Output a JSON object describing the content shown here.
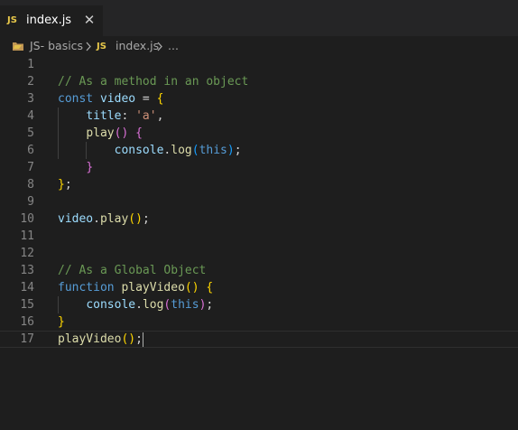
{
  "tab": {
    "badge": "JS",
    "filename": "index.js",
    "close_glyph": "✕"
  },
  "breadcrumb": {
    "folder": "JS- basics",
    "separator": ">",
    "file_badge": "JS",
    "file": "index.js",
    "more": "..."
  },
  "editor": {
    "language": "javascript",
    "active_line": 17,
    "lines": [
      {
        "n": "1",
        "tokens": []
      },
      {
        "n": "2",
        "tokens": [
          {
            "t": "// As a method in an object",
            "c": "comment"
          }
        ]
      },
      {
        "n": "3",
        "tokens": [
          {
            "t": "const",
            "c": "kw"
          },
          {
            "t": " ",
            "c": "punc"
          },
          {
            "t": "video",
            "c": "var"
          },
          {
            "t": " = ",
            "c": "punc"
          },
          {
            "t": "{",
            "c": "b1"
          }
        ]
      },
      {
        "n": "4",
        "tokens": [
          {
            "t": "    ",
            "c": "punc"
          },
          {
            "t": "title",
            "c": "prop"
          },
          {
            "t": ": ",
            "c": "punc"
          },
          {
            "t": "'a'",
            "c": "str"
          },
          {
            "t": ",",
            "c": "punc"
          }
        ]
      },
      {
        "n": "5",
        "tokens": [
          {
            "t": "    ",
            "c": "punc"
          },
          {
            "t": "play",
            "c": "fn"
          },
          {
            "t": "()",
            "c": "b2"
          },
          {
            "t": " ",
            "c": "punc"
          },
          {
            "t": "{",
            "c": "b2"
          }
        ]
      },
      {
        "n": "6",
        "tokens": [
          {
            "t": "        ",
            "c": "punc"
          },
          {
            "t": "console",
            "c": "var"
          },
          {
            "t": ".",
            "c": "punc"
          },
          {
            "t": "log",
            "c": "fn"
          },
          {
            "t": "(",
            "c": "b3"
          },
          {
            "t": "this",
            "c": "this"
          },
          {
            "t": ")",
            "c": "b3"
          },
          {
            "t": ";",
            "c": "punc"
          }
        ]
      },
      {
        "n": "7",
        "tokens": [
          {
            "t": "    ",
            "c": "punc"
          },
          {
            "t": "}",
            "c": "b2"
          }
        ]
      },
      {
        "n": "8",
        "tokens": [
          {
            "t": "}",
            "c": "b1"
          },
          {
            "t": ";",
            "c": "punc"
          }
        ]
      },
      {
        "n": "9",
        "tokens": []
      },
      {
        "n": "10",
        "tokens": [
          {
            "t": "video",
            "c": "var"
          },
          {
            "t": ".",
            "c": "punc"
          },
          {
            "t": "play",
            "c": "fn"
          },
          {
            "t": "()",
            "c": "b1"
          },
          {
            "t": ";",
            "c": "punc"
          }
        ]
      },
      {
        "n": "11",
        "tokens": []
      },
      {
        "n": "12",
        "tokens": []
      },
      {
        "n": "13",
        "tokens": [
          {
            "t": "// As a Global Object",
            "c": "comment"
          }
        ]
      },
      {
        "n": "14",
        "tokens": [
          {
            "t": "function",
            "c": "kw"
          },
          {
            "t": " ",
            "c": "punc"
          },
          {
            "t": "playVideo",
            "c": "fn"
          },
          {
            "t": "()",
            "c": "b1"
          },
          {
            "t": " ",
            "c": "punc"
          },
          {
            "t": "{",
            "c": "b1"
          }
        ]
      },
      {
        "n": "15",
        "tokens": [
          {
            "t": "    ",
            "c": "punc"
          },
          {
            "t": "console",
            "c": "var"
          },
          {
            "t": ".",
            "c": "punc"
          },
          {
            "t": "log",
            "c": "fn"
          },
          {
            "t": "(",
            "c": "b2"
          },
          {
            "t": "this",
            "c": "this"
          },
          {
            "t": ")",
            "c": "b2"
          },
          {
            "t": ";",
            "c": "punc"
          }
        ]
      },
      {
        "n": "16",
        "tokens": [
          {
            "t": "}",
            "c": "b1"
          }
        ]
      },
      {
        "n": "17",
        "tokens": [
          {
            "t": "playVideo",
            "c": "fn"
          },
          {
            "t": "()",
            "c": "b1"
          },
          {
            "t": ";",
            "c": "punc"
          }
        ]
      }
    ]
  },
  "colors": {
    "editor_bg": "#1e1e1e",
    "tabbar_bg": "#252526",
    "js_badge": "#e8c84a",
    "comment": "#6a9955",
    "keyword": "#569cd6",
    "variable": "#9cdcfe",
    "function": "#dcdcaa",
    "string": "#ce9178",
    "bracket_1": "#ffd700",
    "bracket_2": "#da70d6",
    "bracket_3": "#179fff",
    "line_number": "#858585"
  },
  "icons": {
    "folder": "folder-icon",
    "close": "close-icon",
    "chevron": "chevron-right-icon"
  }
}
